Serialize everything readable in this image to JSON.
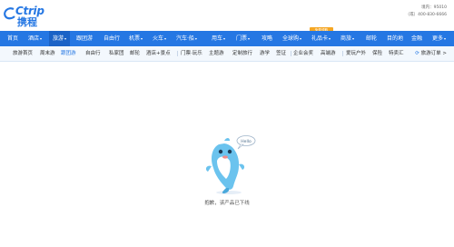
{
  "brand": {
    "logo_en": "Ctrip",
    "logo_cn": "携程",
    "hotline_line": "境内：95010",
    "hotline_abroad": "（或）400-830-6666"
  },
  "nav": {
    "items": [
      "首页",
      "酒店",
      "旅游",
      "跟团游",
      "自由行",
      "机票",
      "火车",
      "汽车·船",
      "用车",
      "门票",
      "攻略",
      "全球购",
      "礼品卡",
      "商旅",
      "邮轮",
      "目的地",
      "金融",
      "更多"
    ],
    "badge": "免费领取"
  },
  "subnav": {
    "items": [
      "旅游首页",
      "周末游",
      "跟团游",
      "自由行",
      "私家团",
      "邮轮",
      "酒店+景点",
      "门票·玩乐",
      "主题游",
      "定制旅行",
      "游学",
      "签证",
      "企业会奖",
      "高端游",
      "爱玩户外",
      "保险",
      "特卖汇"
    ],
    "orders": "旅游订单 >"
  },
  "mascot": {
    "bubble_text": "Hello"
  },
  "message": "抱歉，该产品已下线",
  "colors": {
    "brand_blue": "#2577e3",
    "active_nav": "#1a62c6",
    "badge": "#f5a623"
  }
}
